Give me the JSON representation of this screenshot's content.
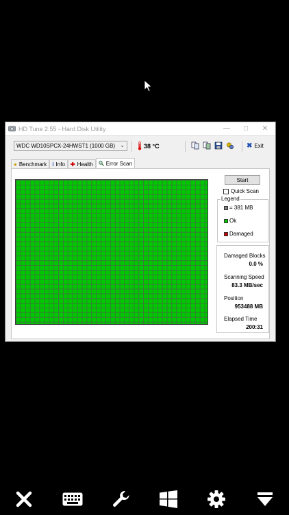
{
  "window": {
    "title": "HD Tune 2.55 - Hard Disk Utility",
    "minimize": "—",
    "maximize": "□",
    "close": "✕"
  },
  "toolbar": {
    "drive": "WDC    WD10SPCX-24HWST1 (1000 GB)",
    "temperature": "38 °C",
    "exit_label": "Exit"
  },
  "tabs": [
    {
      "label": "Benchmark"
    },
    {
      "label": "Info"
    },
    {
      "label": "Health"
    },
    {
      "label": "Error Scan"
    }
  ],
  "error_scan": {
    "start_label": "Start",
    "quick_scan_label": "Quick Scan",
    "legend_title": "Legend",
    "legend": [
      {
        "label": "= 381 MB",
        "color": "#808080"
      },
      {
        "label": "Ok",
        "color": "#00c800"
      },
      {
        "label": "Damaged",
        "color": "#c80000"
      }
    ],
    "stats": {
      "damaged_blocks_label": "Damaged Blocks",
      "damaged_blocks_value": "0.0 %",
      "scanning_speed_label": "Scanning Speed",
      "scanning_speed_value": "83.3 MB/sec",
      "position_label": "Position",
      "position_value": "953488 MB",
      "elapsed_label": "Elapsed Time",
      "elapsed_value": "200:31"
    }
  },
  "bottom_bar": {
    "icons": [
      "close-icon",
      "keyboard-icon",
      "wrench-icon",
      "windows-icon",
      "gear-icon",
      "dropdown-icon"
    ]
  }
}
